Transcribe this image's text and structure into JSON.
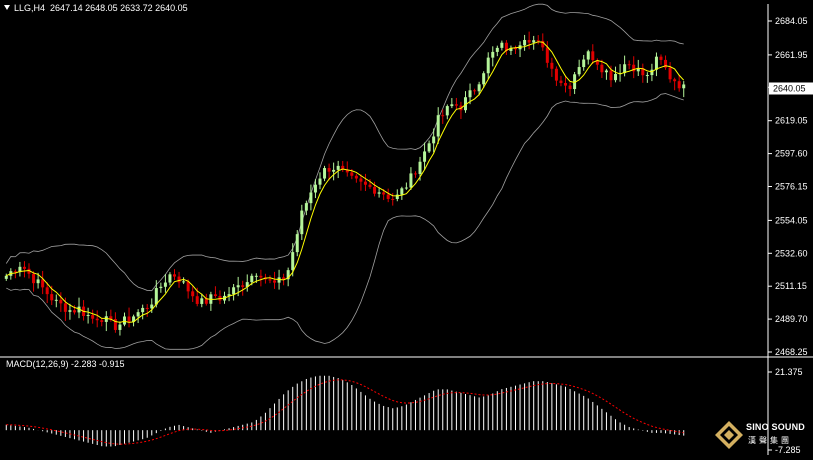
{
  "header": {
    "symbol": "LLG,H4",
    "ohlc": "2647.14 2648.05 2633.72 2640.05"
  },
  "macd_header": {
    "label": "MACD(12,26,9) -2.283 -0.915"
  },
  "watermark": {
    "brand": "SINO SOUND",
    "brand_cn": "漢聲集團"
  },
  "colors": {
    "background": "#000000",
    "axis": "#ffffff",
    "bull_candle": "#b5f59a",
    "bear_candle": "#e00000",
    "bollinger": "#a0a0a0",
    "moving_average": "#ffff00",
    "macd_hist": "#ffffff",
    "macd_signal": "#ff0000",
    "price_label_bg": "#ffffff",
    "price_label_text": "#000000"
  },
  "chart_data": [
    {
      "type": "candlestick",
      "name": "LLG H4 price",
      "ylim": [
        2468.25,
        2695.0
      ],
      "y_ticks": [
        "2684.05",
        "2661.95",
        "2640.85",
        "2619.05",
        "2597.60",
        "2576.15",
        "2554.05",
        "2532.60",
        "2511.15",
        "2489.70",
        "2468.25"
      ],
      "current_price": "2640.05",
      "indicators": [
        "Bollinger Bands",
        "Moving Average"
      ],
      "close_path": [
        2518,
        2522,
        2526,
        2520,
        2515,
        2510,
        2505,
        2500,
        2498,
        2495,
        2497,
        2493,
        2490,
        2492,
        2488,
        2485,
        2487,
        2490,
        2493,
        2496,
        2500,
        2508,
        2515,
        2520,
        2516,
        2510,
        2505,
        2500,
        2502,
        2505,
        2503,
        2507,
        2510,
        2514,
        2518,
        2522,
        2516,
        2512,
        2514,
        2520,
        2538,
        2558,
        2570,
        2580,
        2586,
        2589,
        2588,
        2583,
        2580,
        2578,
        2576,
        2575,
        2573,
        2570,
        2568,
        2574,
        2580,
        2590,
        2598,
        2608,
        2620,
        2625,
        2630,
        2628,
        2634,
        2640,
        2650,
        2660,
        2665,
        2668,
        2664,
        2670,
        2675,
        2672,
        2668,
        2660,
        2650,
        2645,
        2640,
        2652,
        2660,
        2663,
        2658,
        2652,
        2648,
        2652,
        2657,
        2655,
        2650,
        2647,
        2658,
        2657,
        2648,
        2645,
        2640
      ]
    },
    {
      "type": "bar",
      "name": "MACD(12,26,9)",
      "ylim": [
        -7.285,
        21.375
      ],
      "y_ticks": [
        "21.375",
        "-7.285"
      ],
      "macd": -2.283,
      "signal": -0.915,
      "hist_path": [
        2,
        1.5,
        1,
        0,
        -1,
        -2,
        -3,
        -4,
        -5,
        -6,
        -6,
        -5,
        -4,
        -3,
        -1,
        1,
        2,
        1,
        0,
        -1,
        0,
        1,
        2,
        3,
        6,
        10,
        14,
        17,
        19,
        20,
        20,
        19,
        17,
        14,
        11,
        9,
        8,
        9,
        11,
        13,
        15,
        15,
        14,
        13,
        12,
        13,
        15,
        16,
        17,
        18,
        18,
        17,
        16,
        14,
        12,
        9,
        6,
        3,
        1,
        0,
        -1,
        -1,
        -1.5,
        -2
      ]
    }
  ]
}
